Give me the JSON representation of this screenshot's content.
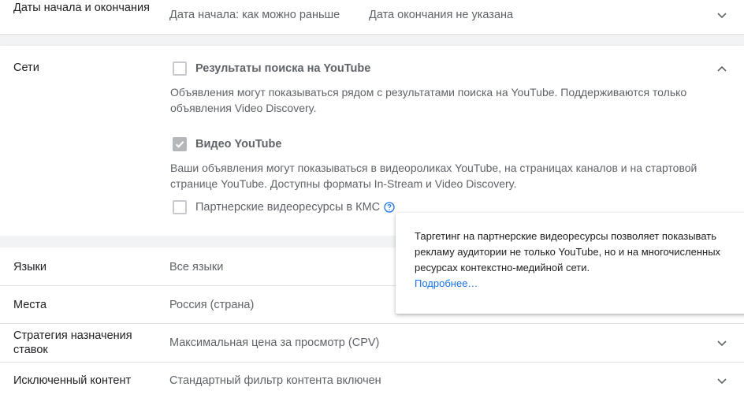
{
  "dates": {
    "label": "Даты начала и окончания",
    "start_value": "Дата начала: как можно раньше",
    "end_value": "Дата окончания не указана"
  },
  "networks": {
    "label": "Сети",
    "youtube_search": {
      "label": "Результаты поиска на YouTube",
      "checked": false,
      "description": "Объявления могут показываться рядом с результатами поиска на YouTube. Поддерживаются только объявления Video Discovery."
    },
    "youtube_videos": {
      "label": "Видео YouTube",
      "checked": true,
      "description": "Ваши объявления могут показываться в видеороликах YouTube, на страницах каналов и на стартовой странице YouTube. Доступны форматы In-Stream и Video Discovery."
    },
    "partner_video": {
      "label": "Партнерские видеоресурсы в КМС",
      "checked": false
    }
  },
  "tooltip": {
    "text": "Таргетинг на партнерские видеоресурсы позволяет показывать рекламу аудитории не только YouTube, но и на многочисленных ресурсах контекстно-медийной сети.",
    "link": "Подробнее…"
  },
  "languages": {
    "label": "Языки",
    "value": "Все языки"
  },
  "locations": {
    "label": "Места",
    "value": "Россия (страна)"
  },
  "bidding": {
    "label": "Стратегия назначения ставок",
    "value": "Максимальная цена за просмотр (CPV)"
  },
  "excluded": {
    "label": "Исключенный контент",
    "value": "Стандартный фильтр контента включен"
  },
  "colors": {
    "accent_link": "#1a73e8",
    "help_icon": "#1a73e8",
    "text_primary": "#202124",
    "text_secondary": "#5f6368"
  }
}
